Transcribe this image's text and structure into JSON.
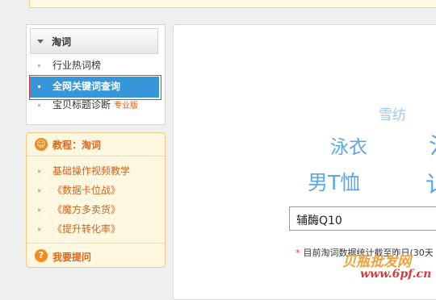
{
  "sidebar": {
    "title": "淘词",
    "items": [
      {
        "label": "行业热词榜"
      },
      {
        "label": "全网关键词查询"
      },
      {
        "label": "宝贝标题诊断",
        "tag": "专业版"
      }
    ]
  },
  "tutorial": {
    "title": "教程：淘词",
    "items": [
      {
        "label": "基础操作视频教学"
      },
      {
        "label": "《数据卡位战》"
      },
      {
        "label": "《魔方多卖货》"
      },
      {
        "label": "《提升转化率》"
      }
    ],
    "ask_label": "我要提问"
  },
  "cloud": {
    "words": [
      "雪纺",
      "泳衣",
      "男T恤"
    ]
  },
  "search": {
    "value": "辅酶Q10"
  },
  "note": {
    "star": "*",
    "text": "目前淘词数据统计截至昨日(30天"
  },
  "watermark": {
    "line1": "贝瓶批发网",
    "line2": "www.6pf.cn"
  },
  "colors": {
    "accent": "#3696d8",
    "cloud": "#5ea6e6",
    "highlight": "#e0373c",
    "tutorial_text": "#e0651b"
  }
}
